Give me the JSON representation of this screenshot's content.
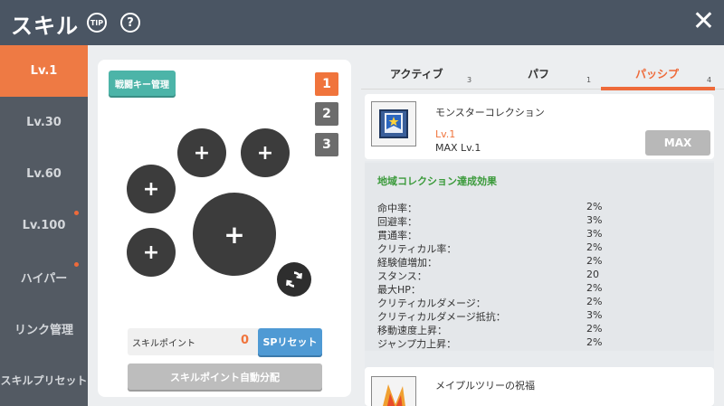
{
  "header": {
    "title": "スキル",
    "tip_label": "TIP",
    "help_label": "?",
    "close_label": "✕"
  },
  "sidebar": {
    "items": [
      {
        "label": "Lv.1",
        "active": true,
        "dot": false
      },
      {
        "label": "Lv.30",
        "active": false,
        "dot": false
      },
      {
        "label": "Lv.60",
        "active": false,
        "dot": false
      },
      {
        "label": "Lv.100",
        "active": false,
        "dot": true
      },
      {
        "label": "ハイパー",
        "active": false,
        "dot": true
      },
      {
        "label": "リンク管理",
        "active": false,
        "dot": false
      },
      {
        "label": "スキルプリセット",
        "active": false,
        "dot": false
      }
    ]
  },
  "left": {
    "key_manage_label": "戦闘キー管理",
    "presets": [
      "1",
      "2",
      "3"
    ],
    "slot_symbol": "+",
    "skill_point_label": "スキルポイント",
    "skill_point_value": "0",
    "sp_reset_label": "SPリセット",
    "auto_assign_label": "スキルポイント自動分配"
  },
  "tabs": [
    {
      "label": "アクティブ",
      "count": "3"
    },
    {
      "label": "パフ",
      "count": "1"
    },
    {
      "label": "パッシプ",
      "count": "4",
      "active": true
    }
  ],
  "skill": {
    "name": "モンスターコレクション",
    "level": "Lv.1",
    "max_level": "MAX Lv.1",
    "max_button": "MAX"
  },
  "effect": {
    "title": "地域コレクション達成効果",
    "stats": [
      {
        "k": "命中率：",
        "v": "2%"
      },
      {
        "k": "回避率：",
        "v": "3%"
      },
      {
        "k": "貫通率：",
        "v": "3%"
      },
      {
        "k": "クリティカル率：",
        "v": "2%"
      },
      {
        "k": "経験値増加：",
        "v": "2%"
      },
      {
        "k": "スタンス：",
        "v": "20"
      },
      {
        "k": "最大HP：",
        "v": "2%"
      },
      {
        "k": "クリティカルダメージ：",
        "v": "2%"
      },
      {
        "k": "クリティカルダメージ抵抗：",
        "v": "3%"
      },
      {
        "k": "移動速度上昇：",
        "v": "2%"
      },
      {
        "k": "ジャンプ力上昇：",
        "v": "2%"
      }
    ]
  },
  "skill2": {
    "name": "メイプルツリーの祝福"
  },
  "colors": {
    "accent": "#ee7a44",
    "header": "#4a5563",
    "sidebar": "#535a63",
    "effect_title": "#3a9a3a",
    "sp_reset": "#4f9ad4",
    "key_manage": "#4cb4a8"
  }
}
